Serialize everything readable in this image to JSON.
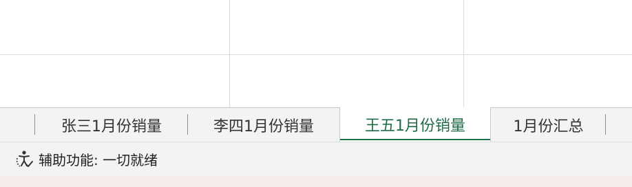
{
  "sheet_tabs": [
    {
      "label": "张三1月份销量",
      "active": false
    },
    {
      "label": "李四1月份销量",
      "active": false
    },
    {
      "label": "王五1月份销量",
      "active": true
    },
    {
      "label": "1月份汇总",
      "active": false
    }
  ],
  "status_bar": {
    "accessibility_label": "辅助功能: 一切就绪",
    "accessibility_icon": "accessibility-check-icon"
  },
  "colors": {
    "active_tab_text": "#1f6b46",
    "active_tab_underline": "#1e7145",
    "tabbar_bg": "#f3f3f3",
    "gridline": "#d9d9d9"
  }
}
